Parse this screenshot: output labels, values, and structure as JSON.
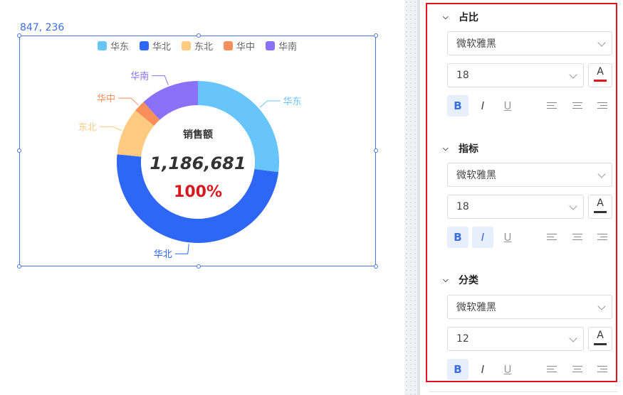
{
  "canvas": {
    "coord_label": "847, 236",
    "legend": [
      {
        "label": "华东",
        "color": "#67c5fb"
      },
      {
        "label": "华北",
        "color": "#2e66f6"
      },
      {
        "label": "东北",
        "color": "#ffcb80"
      },
      {
        "label": "华中",
        "color": "#fb8f5c"
      },
      {
        "label": "华南",
        "color": "#8a71f9"
      }
    ],
    "center_title": "销售额",
    "center_value": "1,186,681",
    "center_percent": "100%",
    "percent_color": "#d7191f"
  },
  "chart_data": {
    "type": "pie",
    "labels": [
      "华东",
      "华北",
      "东北",
      "华中",
      "华南"
    ],
    "values": [
      27.0,
      49.5,
      9.5,
      2.3,
      11.7
    ],
    "colors": [
      "#67c5fb",
      "#2e66f6",
      "#ffcb80",
      "#fb8f5c",
      "#8a71f9"
    ],
    "donut": true
  },
  "panel": {
    "sections": [
      {
        "title": "占比",
        "font": "微软雅黑",
        "size": "18",
        "color": "#e0151d",
        "italic_active": false
      },
      {
        "title": "指标",
        "font": "微软雅黑",
        "size": "18",
        "color": "#333333",
        "italic_active": true
      },
      {
        "title": "分类",
        "font": "微软雅黑",
        "size": "12",
        "color": "#333333",
        "italic_active": false
      }
    ],
    "bold_label": "B",
    "italic_label": "I",
    "underline_label": "U",
    "color_glyph": "A"
  }
}
